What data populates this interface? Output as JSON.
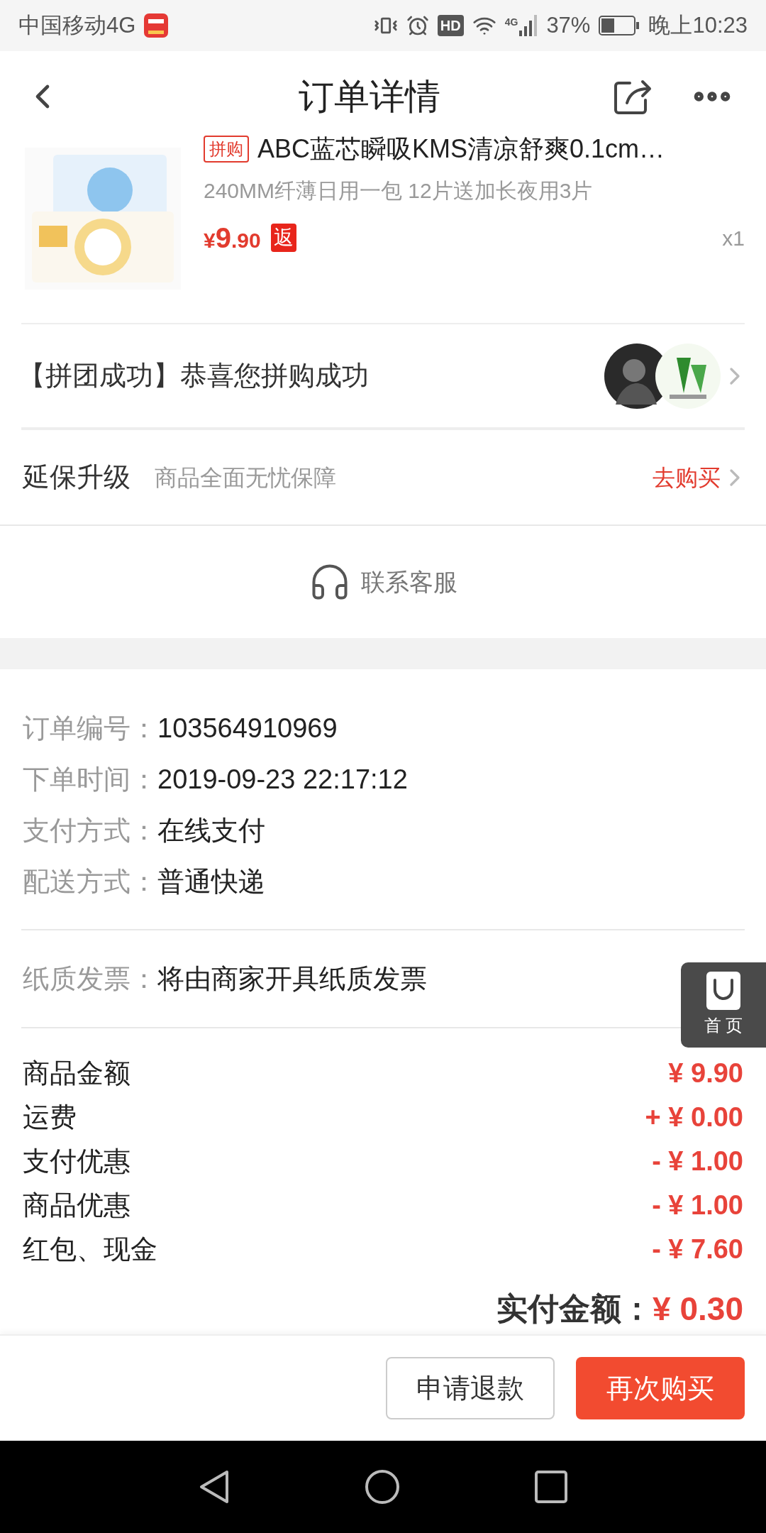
{
  "status_bar": {
    "carrier": "中国移动4G",
    "battery": "37%",
    "time": "晚上10:23",
    "network": "4G",
    "hd": "HD"
  },
  "header": {
    "title": "订单详情"
  },
  "product": {
    "tag": "拼购",
    "title": "ABC蓝芯瞬吸KMS清凉舒爽0.1cm…",
    "spec": "240MM纤薄日用一包 12片送加长夜用3片",
    "price_symbol": "¥",
    "price_int": "9",
    "price_dec": ".90",
    "rebate_badge": "返",
    "quantity": "x1"
  },
  "group": {
    "text": "【拼团成功】恭喜您拼购成功"
  },
  "warranty": {
    "title": "延保升级",
    "subtitle": "商品全面无忧保障",
    "action": "去购买"
  },
  "contact": {
    "label": "联系客服"
  },
  "info": [
    {
      "label": "订单编号：",
      "value": "103564910969"
    },
    {
      "label": "下单时间：",
      "value": "2019-09-23 22:17:12"
    },
    {
      "label": "支付方式：",
      "value": "在线支付"
    },
    {
      "label": "配送方式：",
      "value": "普通快递"
    }
  ],
  "invoice": {
    "label": "纸质发票：",
    "value": "将由商家开具纸质发票"
  },
  "float_button": {
    "label": "首 页"
  },
  "amounts": [
    {
      "label": "商品金额",
      "value": "¥ 9.90"
    },
    {
      "label": "运费",
      "value": "+ ¥ 0.00"
    },
    {
      "label": "支付优惠",
      "value": "- ¥ 1.00"
    },
    {
      "label": "商品优惠",
      "value": "- ¥ 1.00"
    },
    {
      "label": "红包、现金",
      "value": "- ¥ 7.60"
    }
  ],
  "total": {
    "label": "实付金额：",
    "value": "¥ 0.30"
  },
  "buttons": [
    {
      "label": "申请退款",
      "kind": "outline"
    },
    {
      "label": "再次购买",
      "kind": "primary"
    }
  ]
}
